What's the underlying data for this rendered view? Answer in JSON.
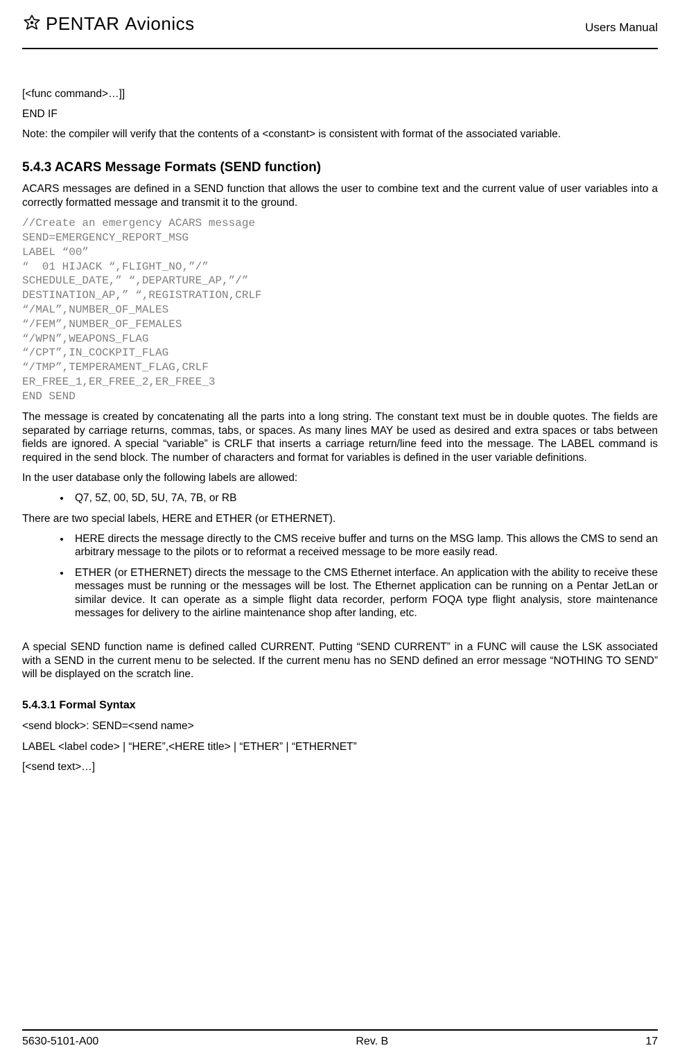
{
  "header": {
    "brand": "PENTAR",
    "brand_suffix": "Avionics",
    "doc_title": "Users Manual"
  },
  "intro": {
    "line1": "[<func command>…]]",
    "line2": "END IF",
    "note": "Note: the compiler will verify that the contents of a <constant> is consistent with format of the associated variable."
  },
  "section_543": {
    "heading": "5.4.3   ACARS Message Formats (SEND function)",
    "para1": "ACARS messages are defined in a SEND function that allows the user to combine text and the current value of user variables into a correctly formatted message and transmit it to the ground.",
    "code": "//Create an emergency ACARS message\nSEND=EMERGENCY_REPORT_MSG\nLABEL “00”\n“  01 HIJACK “,FLIGHT_NO,”/”\nSCHEDULE_DATE,” “,DEPARTURE_AP,”/”\nDESTINATION_AP,” “,REGISTRATION,CRLF\n“/MAL”,NUMBER_OF_MALES\n“/FEM”,NUMBER_OF_FEMALES\n“/WPN”,WEAPONS_FLAG\n“/CPT”,IN_COCKPIT_FLAG\n“/TMP”,TEMPERAMENT_FLAG,CRLF\nER_FREE_1,ER_FREE_2,ER_FREE_3\nEND SEND",
    "para2": "The message is created by concatenating all the parts into a long string.  The constant text must be in double quotes.  The fields are separated by carriage returns, commas, tabs, or spaces.  As many lines MAY be used as desired and extra spaces or tabs between fields are ignored.  A special “variable” is CRLF that inserts a carriage return/line feed into the message.  The LABEL command is required in the send block.  The number of characters and format for variables is defined in the user variable definitions.",
    "para3": "In the user database only the following labels are allowed:",
    "labels_bullet": "Q7, 5Z, 00, 5D, 5U, 7A, 7B, or RB",
    "para4": "There are two special labels, HERE and ETHER (or ETHERNET).",
    "here_bullet": "HERE directs the message directly to the CMS receive buffer and turns on the MSG lamp.  This allows the CMS to send an arbitrary message to the pilots or to reformat a received message to be more easily read.",
    "ether_bullet": "ETHER (or ETHERNET) directs the message to the CMS Ethernet interface.  An application with the ability to receive these messages must be running or the messages will be lost.  The Ethernet application can be running on a Pentar JetLan or similar device.  It can operate as a simple flight data recorder, perform FOQA type flight analysis, store maintenance messages for delivery to the airline maintenance shop after landing, etc.",
    "para5": "A special SEND function name is defined called CURRENT.  Putting “SEND CURRENT” in a FUNC will cause the LSK associated with a SEND in the current menu to be selected.  If the current menu has no SEND defined an error message “NOTHING TO SEND” will be displayed on the scratch line."
  },
  "section_5431": {
    "heading": "5.4.3.1    Formal Syntax",
    "l1": "<send block>: SEND=<send name>",
    "l2": "LABEL <label code> | “HERE”,<HERE title> | “ETHER” | “ETHERNET”",
    "l3": "[<send text>…]"
  },
  "footer": {
    "left": "5630-5101-A00",
    "center": "Rev. B",
    "right": "17"
  }
}
